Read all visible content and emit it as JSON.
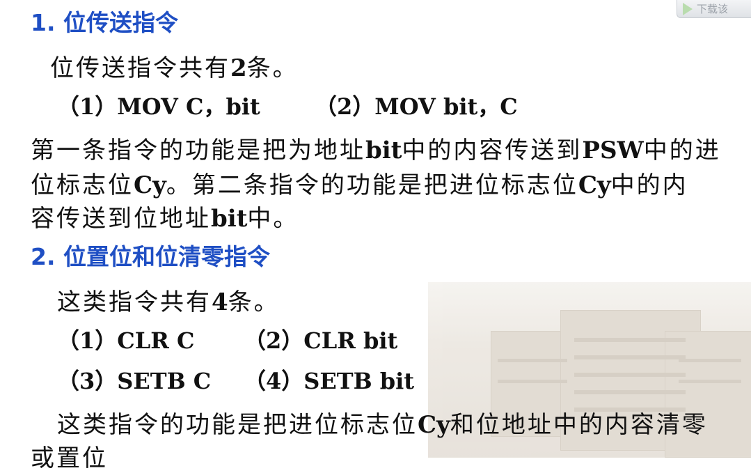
{
  "download_button": {
    "label": "下载该"
  },
  "section1": {
    "heading": "1. 位传送指令",
    "intro": {
      "text": "位传送指令共有",
      "num": "2",
      "tail": "条。"
    },
    "instructions": [
      "（1）MOV  C，bit",
      "（2）MOV  bit，C"
    ],
    "desc_line1": {
      "a": "第一条指令的功能是把为地址",
      "b": "bit",
      "c": "中的内容传送到",
      "d": "PSW",
      "e": "中的进"
    },
    "desc_line2": {
      "a": "位标志位",
      "b": "Cy",
      "c": "。第二条指令的功能是把进位标志位",
      "d": "Cy",
      "e": "中的内"
    },
    "desc_line3": {
      "a": "容传送到位地址",
      "b": "bit",
      "c": "中。"
    }
  },
  "section2": {
    "heading": "2. 位置位和位清零指令",
    "intro": {
      "text": "这类指令共有",
      "num": "4",
      "tail": "条。"
    },
    "instructions": [
      "（1）CLR  C",
      "（2）CLR  bit",
      "（3）SETB C",
      "（4）SETB bit"
    ],
    "desc_line1": {
      "a": "这类指令的功能是把进位标志位",
      "b": "Cy",
      "c": "和位地址中的内容清零"
    },
    "desc_line2": "或置位"
  }
}
